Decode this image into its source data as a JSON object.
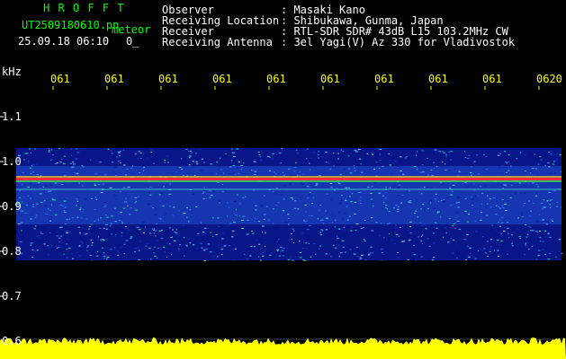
{
  "header": {
    "app_name": "H R O F F T",
    "filename": "UT2509180610.pn",
    "tag": "meteor",
    "datetime": "25.09.18 06:10",
    "flag": "0_",
    "observer_label": "Observer",
    "observer_value": ": Masaki Kano",
    "location_label": "Receiving Location",
    "location_value": ": Shibukawa, Gunma, Japan",
    "receiver_label": "Receiver",
    "receiver_value": ": RTL-SDR SDR# 43dB L15 103.2MHz CW",
    "antenna_label": "Receiving Antenna",
    "antenna_value": ": 3el Yagi(V) Az 330 for Vladivostok"
  },
  "axis": {
    "unit": "kHz",
    "y_ticks": [
      "1.1",
      "1.0",
      "0.9",
      "0.8",
      "0.7",
      "0.6"
    ],
    "time_labels": [
      "061",
      "061",
      "061",
      "061",
      "061",
      "061",
      "061",
      "061",
      "061",
      "0620"
    ]
  },
  "colors": {
    "background": "#000000",
    "header_title": "#00ff00",
    "header_text": "#ffffff",
    "time_labels": "#ffff00",
    "noise_low": "#0a1aa0",
    "noise_mid": "#2f6fff",
    "signal_band": "#ff2a3a",
    "amplitude_trace": "#ffff00"
  }
}
